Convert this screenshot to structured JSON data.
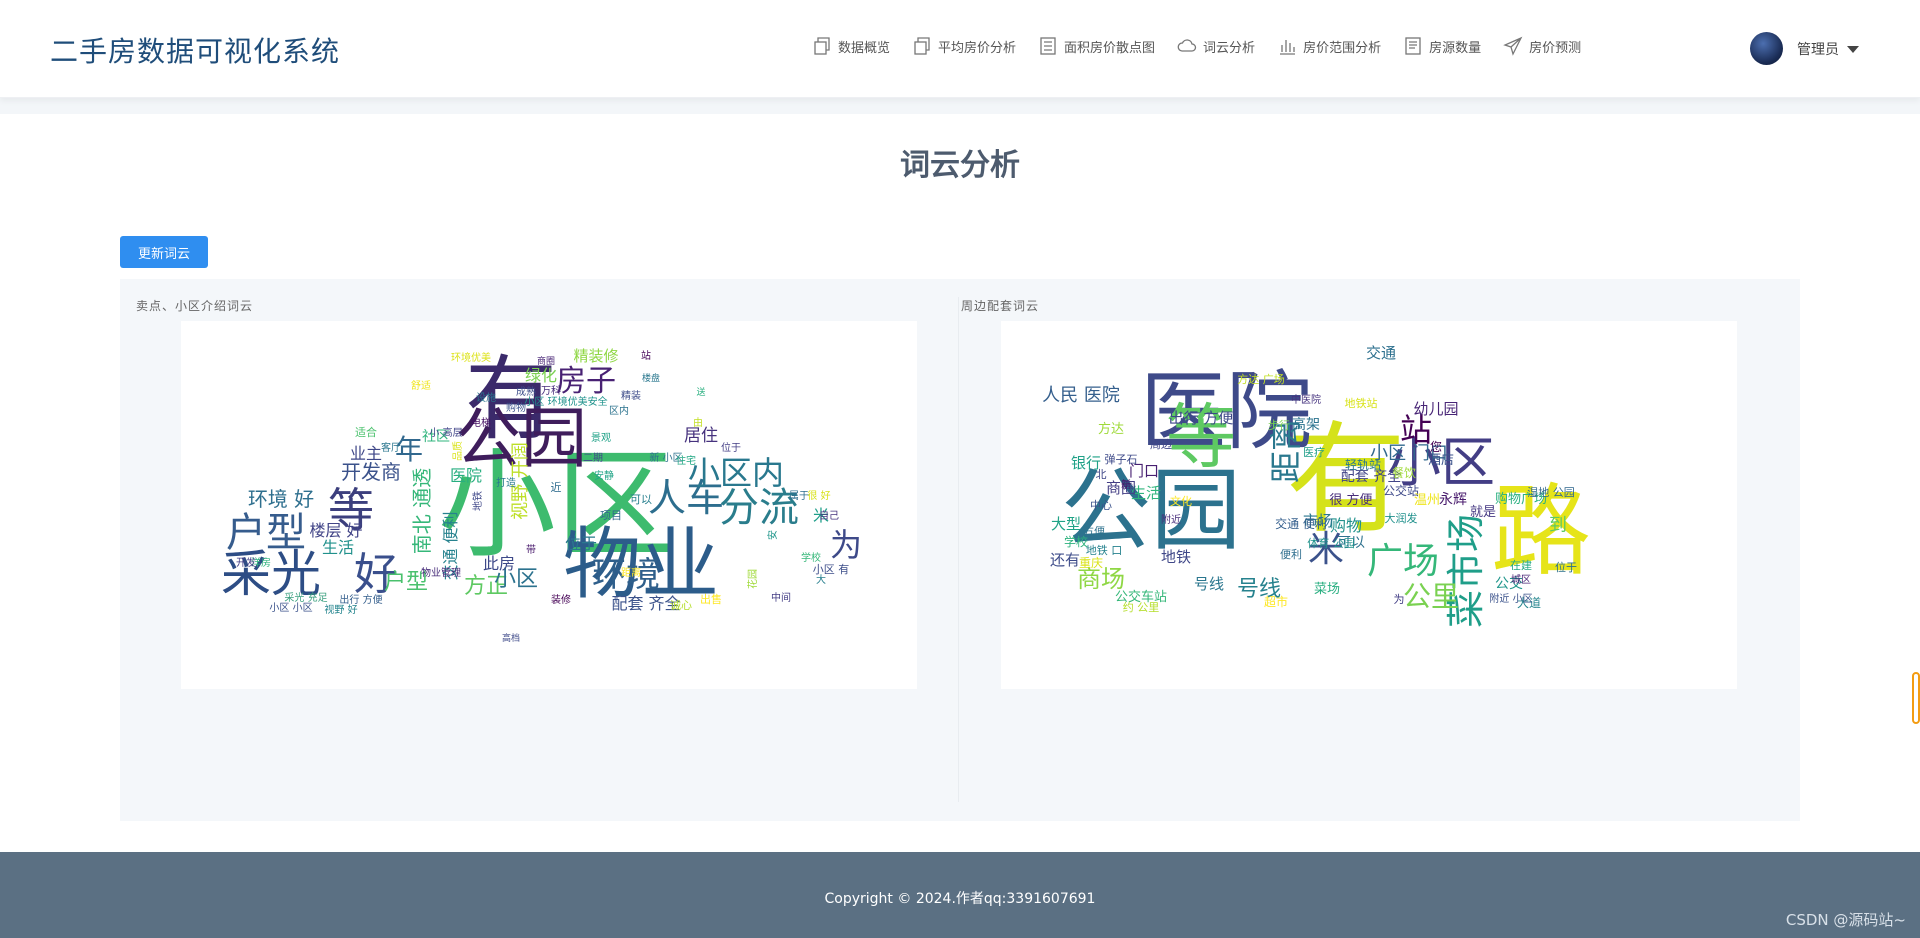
{
  "brand": "二手房数据可视化系统",
  "nav": [
    {
      "label": "数据概览",
      "icon": "copy-icon"
    },
    {
      "label": "平均房价分析",
      "icon": "copy-icon"
    },
    {
      "label": "面积房价散点图",
      "icon": "list-icon"
    },
    {
      "label": "词云分析",
      "icon": "cloud-icon"
    },
    {
      "label": "房价范围分析",
      "icon": "bar-chart-icon"
    },
    {
      "label": "房源数量",
      "icon": "document-icon"
    },
    {
      "label": "房价预测",
      "icon": "send-icon"
    }
  ],
  "user": {
    "name": "管理员",
    "avatar_icon": "avatar-image"
  },
  "page": {
    "title": "词云分析",
    "update_button": "更新词云"
  },
  "clouds": {
    "left_label": "卖点、小区介绍词云",
    "right_label": "周边配套词云"
  },
  "left_cloud_words": [
    {
      "w": "小区",
      "c": "#3dbb6e"
    },
    {
      "w": "有",
      "c": "#3b2a6b"
    },
    {
      "w": "公园",
      "c": "#3f1d5c"
    },
    {
      "w": "物业",
      "c": "#2c5c8a"
    },
    {
      "w": "采光",
      "c": "#2d4d85"
    },
    {
      "w": "好",
      "c": "#3a4f8c"
    },
    {
      "w": "户型",
      "c": "#365c8d"
    },
    {
      "w": "等",
      "c": "#3c3f7d"
    },
    {
      "w": "人车",
      "c": "#2d6e8e"
    },
    {
      "w": "分流",
      "c": "#2a7d8c"
    },
    {
      "w": "环境",
      "c": "#2f5f8b"
    },
    {
      "w": "小区内",
      "c": "#29788e"
    },
    {
      "w": "房子",
      "c": "#482173"
    },
    {
      "w": "年",
      "c": "#31688e"
    },
    {
      "w": "为",
      "c": "#3e4a89"
    },
    {
      "w": "开发商",
      "c": "#3b528b"
    },
    {
      "w": "环境 好",
      "c": "#2e6f8e"
    },
    {
      "w": "方正",
      "c": "#5ec962"
    },
    {
      "w": "户型",
      "c": "#4ac16d"
    },
    {
      "w": "精装修",
      "c": "#8fd744"
    },
    {
      "w": "小区",
      "c": "#2c728e"
    },
    {
      "w": "居住",
      "c": "#46327e"
    },
    {
      "w": "配套 齐全",
      "c": "#3b528b"
    },
    {
      "w": "业主",
      "c": "#3f4788"
    },
    {
      "w": "楼层 好",
      "c": "#414487"
    },
    {
      "w": "生活",
      "c": "#21918c"
    },
    {
      "w": "米",
      "c": "#1f9e89"
    },
    {
      "w": "此房",
      "c": "#3e4989"
    },
    {
      "w": "位于",
      "c": "#2a788e"
    },
    {
      "w": "医院",
      "c": "#28ae80"
    },
    {
      "w": "绿化",
      "c": "#7ad151"
    },
    {
      "w": "南北 通透",
      "c": "#35b779"
    },
    {
      "w": "社区",
      "c": "#2fb47c"
    },
    {
      "w": "交通 便利",
      "c": "#26828e"
    },
    {
      "w": "视野 开阔",
      "c": "#bddf26"
    },
    {
      "w": "近",
      "c": "#2f6c8e"
    },
    {
      "w": "小区 有",
      "c": "#3d4e8a"
    },
    {
      "w": "项目",
      "c": "#31688e"
    },
    {
      "w": "可以",
      "c": "#277f8e"
    },
    {
      "w": "出售",
      "c": "#fde725"
    },
    {
      "w": "诚心",
      "c": "#b5de2b"
    },
    {
      "w": "出行 方便",
      "c": "#355f8d"
    },
    {
      "w": "采光 充足",
      "c": "#3ba07f"
    },
    {
      "w": "洋房",
      "c": "#2db27d"
    },
    {
      "w": "开发",
      "c": "#433e85"
    },
    {
      "w": "很 好",
      "c": "#d8e219"
    },
    {
      "w": "装修",
      "c": "#440154"
    },
    {
      "w": "花园",
      "c": "#a0da39"
    },
    {
      "w": "小区 小区",
      "c": "#3b528b"
    },
    {
      "w": "视野 好",
      "c": "#25858e"
    },
    {
      "w": "环境优美",
      "c": "#dde318"
    },
    {
      "w": "商圈",
      "c": "#482576"
    },
    {
      "w": "电梯",
      "c": "#471164"
    },
    {
      "w": "打造",
      "c": "#297a8e"
    },
    {
      "w": "购物",
      "c": "#3b528b"
    },
    {
      "w": "万科",
      "c": "#472d7b"
    },
    {
      "w": "精装",
      "c": "#3e4c8a"
    },
    {
      "w": "小区 环境优美安全",
      "c": "#20938c"
    },
    {
      "w": "景观",
      "c": "#1fa187"
    },
    {
      "w": "适合",
      "c": "#4ac16d"
    },
    {
      "w": "客厅",
      "c": "#2a768e"
    },
    {
      "w": "大",
      "c": "#277f8e"
    },
    {
      "w": "中间",
      "c": "#433d84"
    },
    {
      "w": "距离",
      "c": "#fde725"
    },
    {
      "w": "二期",
      "c": "#3f4a8a"
    },
    {
      "w": "新 小区",
      "c": "#2d708e"
    },
    {
      "w": "住宅",
      "c": "#22a884"
    },
    {
      "w": "属于",
      "c": "#2e6e8e"
    },
    {
      "w": "自己",
      "c": "#46337f"
    },
    {
      "w": "安",
      "c": "#1f968b"
    },
    {
      "w": "由",
      "c": "#c2df23"
    },
    {
      "w": "站",
      "c": "#450559"
    },
    {
      "w": "带",
      "c": "#481a6c"
    },
    {
      "w": "设施",
      "c": "#2a768e"
    },
    {
      "w": "成熟",
      "c": "#3d4d8a"
    },
    {
      "w": "舒适",
      "c": "#efe51c"
    },
    {
      "w": "小 高层",
      "c": "#404588"
    },
    {
      "w": "区内",
      "c": "#2c738e"
    },
    {
      "w": "位于",
      "c": "#433e85"
    },
    {
      "w": "安静",
      "c": "#20a386"
    },
    {
      "w": "地铁",
      "c": "#3f4788"
    },
    {
      "w": "学校",
      "c": "#35b779"
    },
    {
      "w": "物业管理",
      "c": "#472c7a"
    },
    {
      "w": "品质",
      "c": "#dae319"
    },
    {
      "w": "楼盘",
      "c": "#2a778e"
    },
    {
      "w": "高档",
      "c": "#3e4a89"
    },
    {
      "w": "送",
      "c": "#29af7f"
    }
  ],
  "right_cloud_words": [
    {
      "w": "有",
      "c": "#d5e21a"
    },
    {
      "w": "路",
      "c": "#e6e419"
    },
    {
      "w": "医院",
      "c": "#3e4a89"
    },
    {
      "w": "公园",
      "c": "#2c728e"
    },
    {
      "w": "等",
      "c": "#5ec962"
    },
    {
      "w": "小区",
      "c": "#433e85"
    },
    {
      "w": "距离",
      "c": "#2a788e"
    },
    {
      "w": "菜市场",
      "c": "#1f9e89"
    },
    {
      "w": "广场",
      "c": "#35b779"
    },
    {
      "w": "公里",
      "c": "#7ad151"
    },
    {
      "w": "米",
      "c": "#3b528b"
    },
    {
      "w": "号线",
      "c": "#26828e"
    },
    {
      "w": "站",
      "c": "#440154"
    },
    {
      "w": "商场",
      "c": "#8fd744"
    },
    {
      "w": "人民 医院",
      "c": "#355f8d"
    },
    {
      "w": "小区 门口",
      "c": "#31688e"
    },
    {
      "w": "幼儿园",
      "c": "#482576"
    },
    {
      "w": "出行 方便",
      "c": "#3e4989"
    },
    {
      "w": "交通",
      "c": "#2d708e"
    },
    {
      "w": "购物",
      "c": "#21918c"
    },
    {
      "w": "很 方便",
      "c": "#472d7b"
    },
    {
      "w": "购物广场",
      "c": "#29af7f"
    },
    {
      "w": "就是",
      "c": "#453882"
    },
    {
      "w": "到",
      "c": "#5ec962"
    },
    {
      "w": "大型",
      "c": "#20a386"
    },
    {
      "w": "地铁",
      "c": "#3f4788"
    },
    {
      "w": "号线",
      "c": "#2a768e"
    },
    {
      "w": "生活",
      "c": "#2fb47c"
    },
    {
      "w": "商圈",
      "c": "#433d84"
    },
    {
      "w": "银行",
      "c": "#1fa187"
    },
    {
      "w": "还有",
      "c": "#3e4c8a"
    },
    {
      "w": "配套 齐全",
      "c": "#414487"
    },
    {
      "w": "可以",
      "c": "#2d718e"
    },
    {
      "w": "市场",
      "c": "#2a768e"
    },
    {
      "w": "公交",
      "c": "#1f968b"
    },
    {
      "w": "永辉",
      "c": "#481a6c"
    },
    {
      "w": "酒店",
      "c": "#3b528b"
    },
    {
      "w": "高架",
      "c": "#2c738e"
    },
    {
      "w": "门口",
      "c": "#482071"
    },
    {
      "w": "公交车站",
      "c": "#35b779"
    },
    {
      "w": "方达",
      "c": "#9fda3a"
    },
    {
      "w": "交通 便利",
      "c": "#355f8d"
    },
    {
      "w": "菜场",
      "c": "#28ae80"
    },
    {
      "w": "重庆",
      "c": "#dae319"
    },
    {
      "w": "中医院",
      "c": "#46337f"
    },
    {
      "w": "方达 广场",
      "c": "#c2df23"
    },
    {
      "w": "地铁站",
      "c": "#d8e219"
    },
    {
      "w": "医疗",
      "c": "#1f9e89"
    },
    {
      "w": "中心",
      "c": "#3b528b"
    },
    {
      "w": "便利",
      "c": "#2e6e8e"
    },
    {
      "w": "大道",
      "c": "#25858e"
    },
    {
      "w": "公交站",
      "c": "#3f4a8a"
    },
    {
      "w": "体育 公园",
      "c": "#20938c"
    },
    {
      "w": "超市",
      "c": "#fde725"
    },
    {
      "w": "学校",
      "c": "#2db27d"
    },
    {
      "w": "附近",
      "c": "#472c7a"
    },
    {
      "w": "在建",
      "c": "#22a884"
    },
    {
      "w": "温州",
      "c": "#efe51c"
    },
    {
      "w": "步行",
      "c": "#7ad151"
    },
    {
      "w": "周边",
      "c": "#404588"
    },
    {
      "w": "轻轨站",
      "c": "#2a778e"
    },
    {
      "w": "餐饮",
      "c": "#a0da39"
    },
    {
      "w": "湿地 公园",
      "c": "#31688e"
    },
    {
      "w": "城区",
      "c": "#482576"
    },
    {
      "w": "方便",
      "c": "#2c728e"
    },
    {
      "w": "弹子石",
      "c": "#3e4a89"
    },
    {
      "w": "文化",
      "c": "#fde725"
    },
    {
      "w": "地铁 口",
      "c": "#26828e"
    },
    {
      "w": "北",
      "c": "#3f4788"
    },
    {
      "w": "为",
      "c": "#433e85"
    },
    {
      "w": "您",
      "c": "#440154"
    },
    {
      "w": "大润发",
      "c": "#21918c"
    },
    {
      "w": "位于",
      "c": "#2d708e"
    },
    {
      "w": "约 公里",
      "c": "#b5de2b"
    },
    {
      "w": "新",
      "c": "#471164"
    },
    {
      "w": "附近 小区",
      "c": "#3b528b"
    }
  ],
  "footer": {
    "copyright": "Copyright © 2024.作者qq:3391607691",
    "watermark": "CSDN @源码站~"
  }
}
